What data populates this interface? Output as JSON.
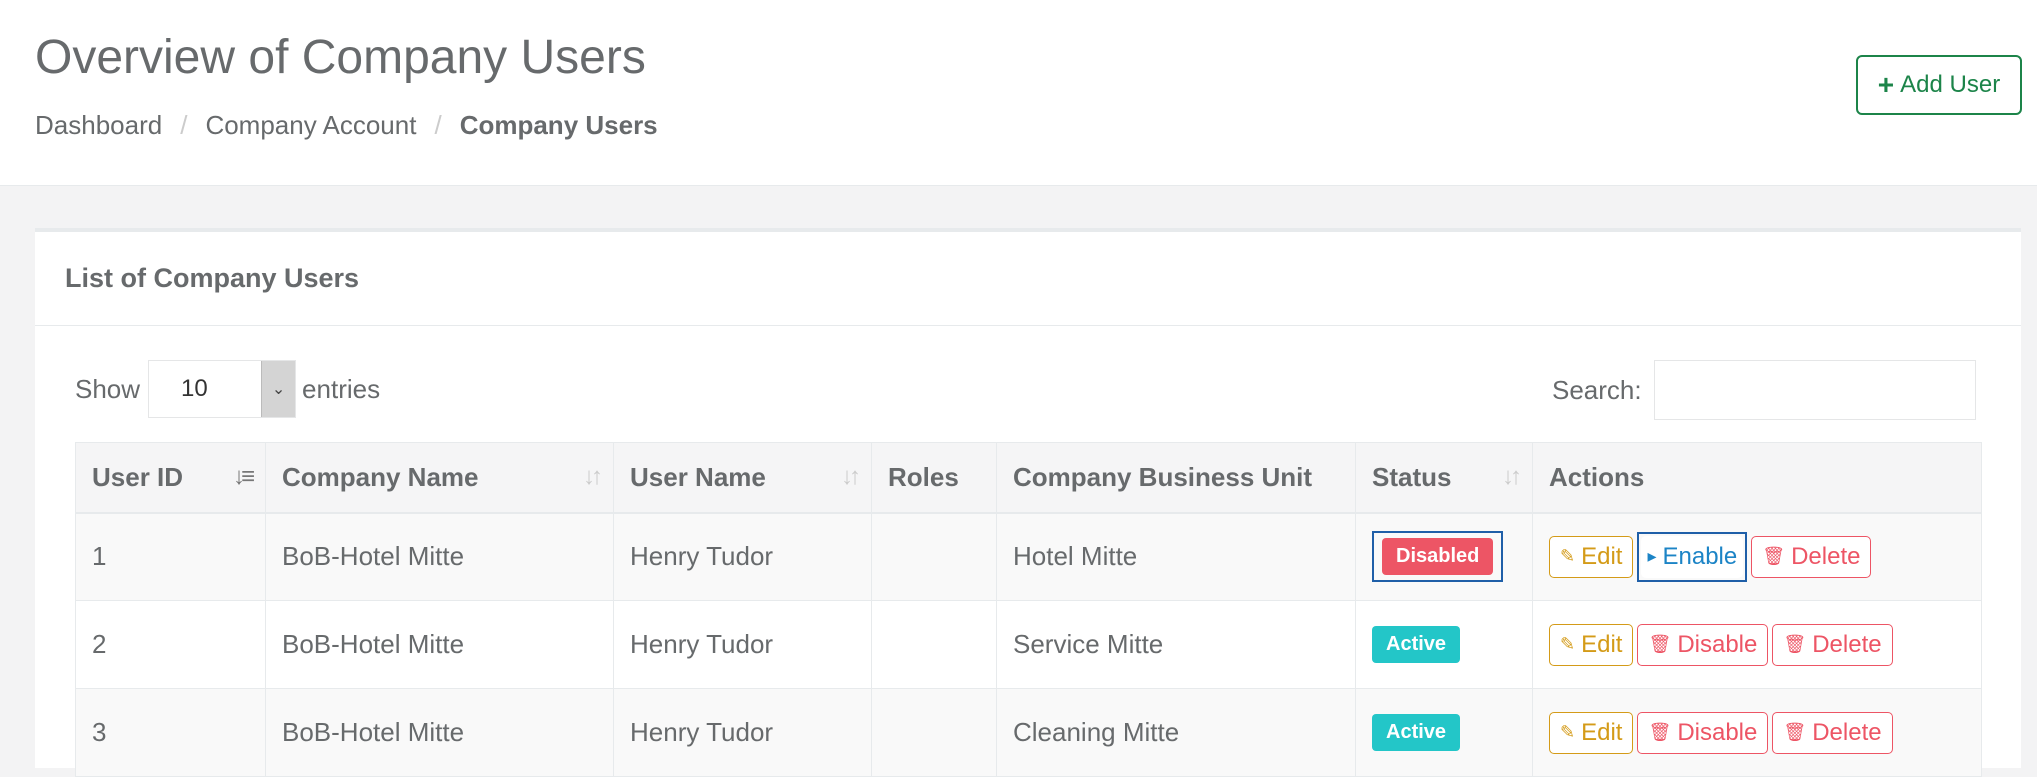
{
  "header": {
    "title": "Overview of Company Users",
    "breadcrumb": [
      "Dashboard",
      "Company Account",
      "Company Users"
    ],
    "add_user_label": "Add User"
  },
  "panel": {
    "title": "List of Company Users",
    "show_label": "Show",
    "entries_value": "10",
    "entries_label": "entries",
    "search_label": "Search:"
  },
  "table": {
    "columns": [
      "User ID",
      "Company Name",
      "User Name",
      "Roles",
      "Company Business Unit",
      "Status",
      "Actions"
    ],
    "rows": [
      {
        "id": "1",
        "company": "BoB-Hotel Mitte",
        "user": "Henry Tudor",
        "roles": "",
        "unit": "Hotel Mitte",
        "status": "Disabled",
        "edit": "Edit",
        "toggle": "Enable",
        "delete": "Delete"
      },
      {
        "id": "2",
        "company": "BoB-Hotel Mitte",
        "user": "Henry Tudor",
        "roles": "",
        "unit": "Service Mitte",
        "status": "Active",
        "edit": "Edit",
        "toggle": "Disable",
        "delete": "Delete"
      },
      {
        "id": "3",
        "company": "BoB-Hotel Mitte",
        "user": "Henry Tudor",
        "roles": "",
        "unit": "Cleaning Mitte",
        "status": "Active",
        "edit": "Edit",
        "toggle": "Disable",
        "delete": "Delete"
      }
    ]
  },
  "colors": {
    "primary": "#1c8449",
    "danger": "#ed5565",
    "info": "#23c6c8",
    "warning": "#d49b18",
    "link": "#1c84c6"
  }
}
